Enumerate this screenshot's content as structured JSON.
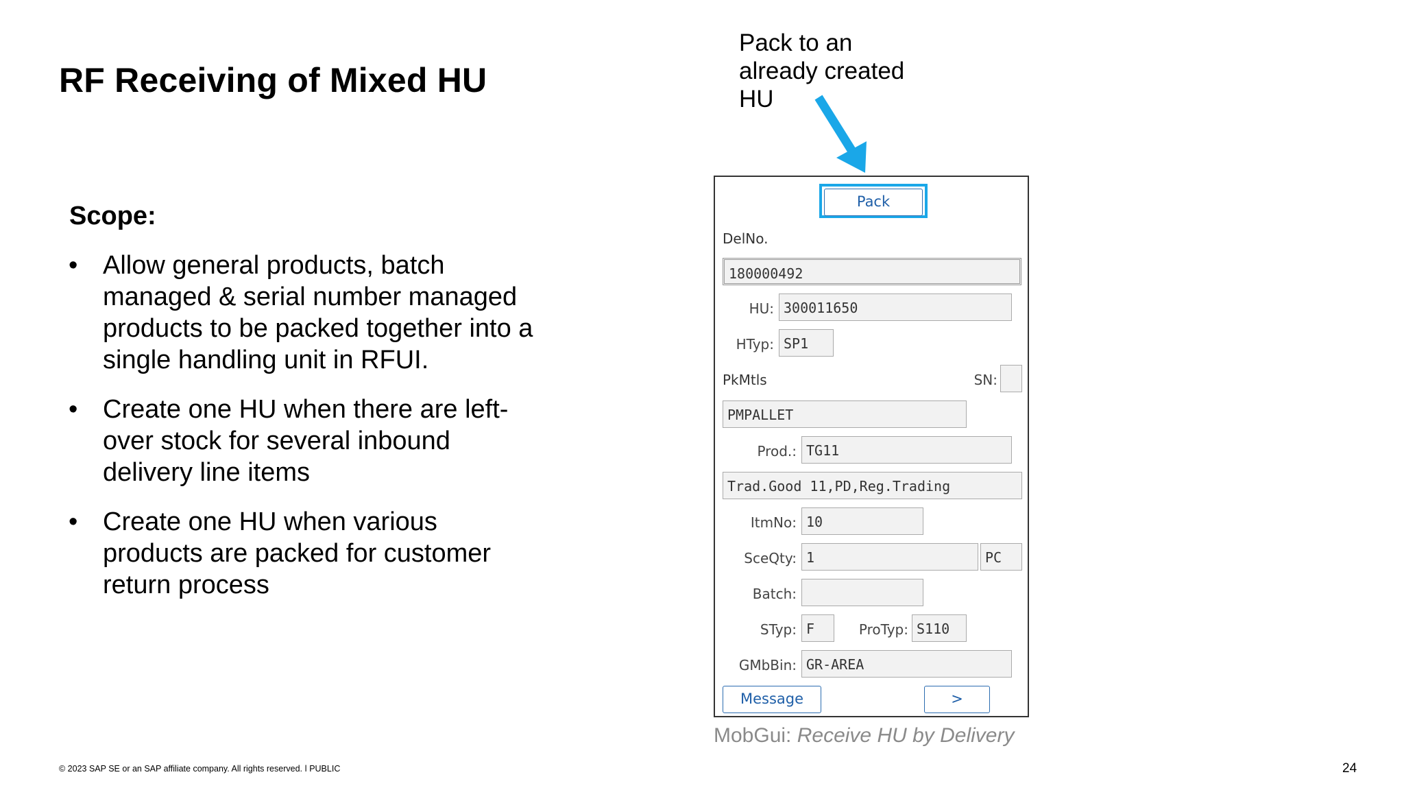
{
  "slide": {
    "title": "RF Receiving of Mixed HU",
    "scope_heading": "Scope:",
    "bullets": [
      "Allow general products, batch managed & serial number managed products to be packed together into a single handling unit in RFUI.",
      "Create one HU when there are left-over stock for several inbound delivery line items",
      "Create one HU when various products are packed for customer return process"
    ],
    "bullet_symbol": "•"
  },
  "annotation": {
    "text_lines": [
      "Pack to an",
      "already created",
      "HU"
    ],
    "arrow_color": "#1aa7e8"
  },
  "device": {
    "pack_button": "Pack",
    "delno_label": "DelNo.",
    "delno_value": "180000492",
    "hu_label": "HU:",
    "hu_value": "300011650",
    "htyp_label": "HTyp:",
    "htyp_value": "SP1",
    "pkmtls_label": "PkMtls",
    "sn_label": "SN:",
    "sn_value": "",
    "pkmtls_value": "PMPALLET",
    "prod_label": "Prod.:",
    "prod_value": "TG11",
    "prod_desc": "Trad.Good 11,PD,Reg.Trading",
    "itmno_label": "ItmNo:",
    "itmno_value": "10",
    "sceqty_label": "SceQty:",
    "sceqty_value": "1",
    "uom_value": "PC",
    "batch_label": "Batch:",
    "batch_value": "",
    "styp_label": "STyp:",
    "styp_value": "F",
    "protyp_label": "ProTyp:",
    "protyp_value": "S110",
    "gmbbin_label": "GMbBin:",
    "gmbbin_value": "GR-AREA",
    "message_button": "Message",
    "next_button": ">"
  },
  "caption": {
    "prefix": "MobGui: ",
    "italic": "Receive HU by Delivery"
  },
  "footer": {
    "copyright": "© 2023 SAP SE or an SAP affiliate company. All rights reserved.  ǀ  PUBLIC",
    "page_number": "24"
  }
}
